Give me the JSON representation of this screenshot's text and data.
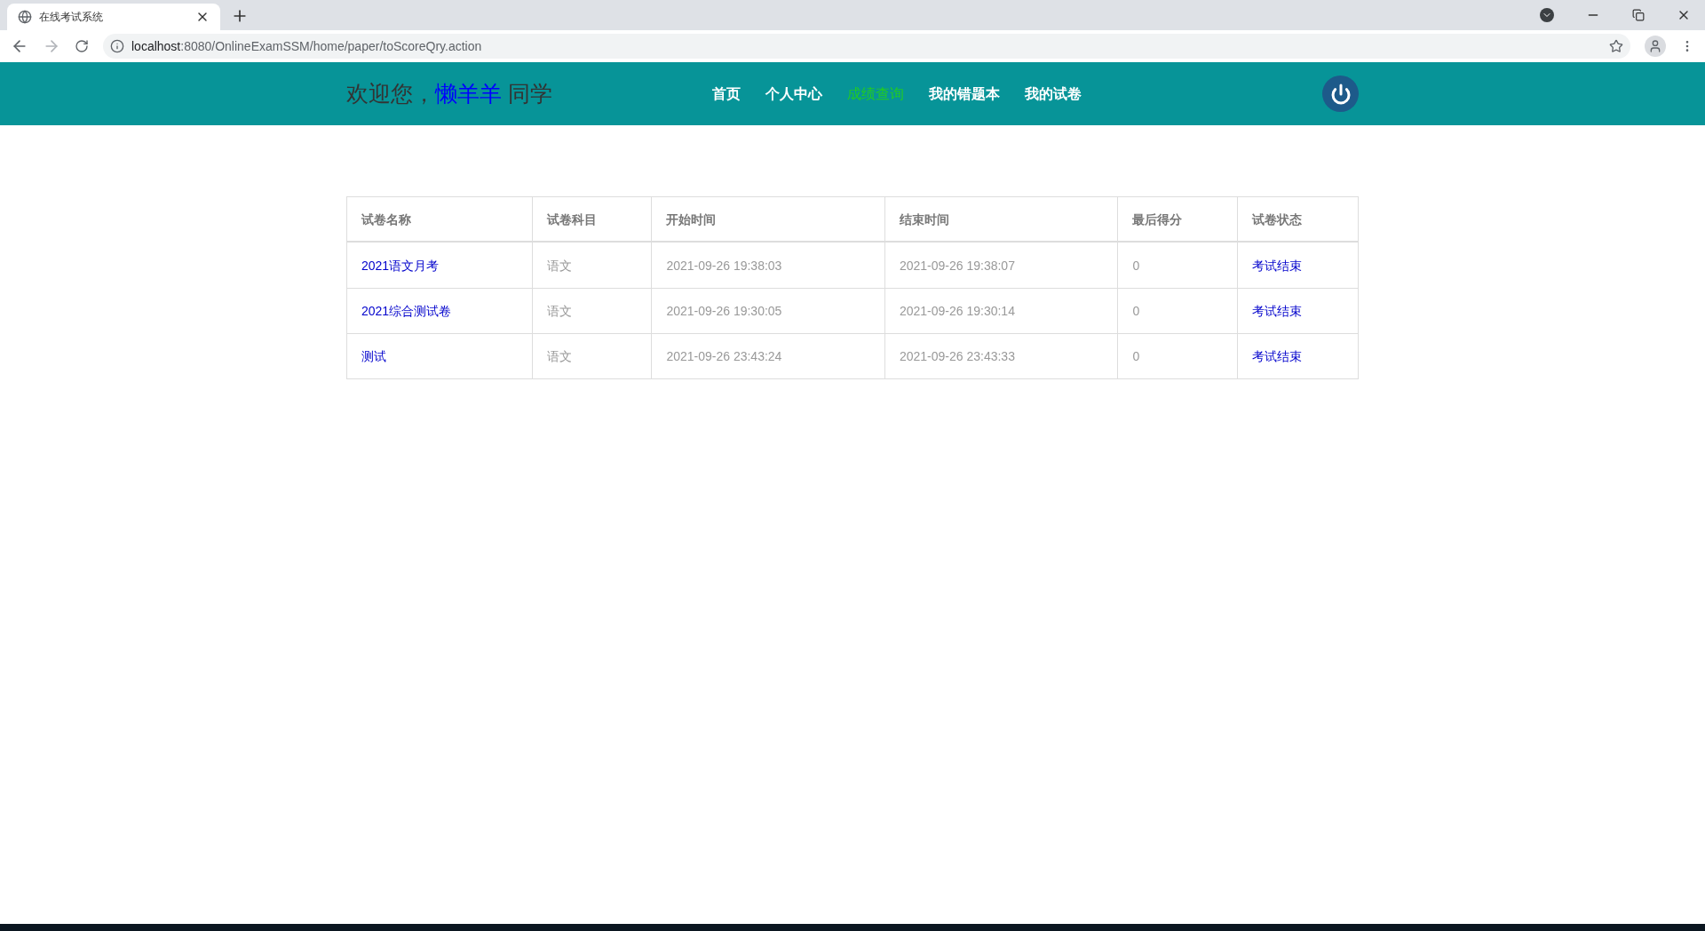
{
  "browser": {
    "tab_title": "在线考试系统",
    "url_host": "localhost",
    "url_rest": ":8080/OnlineExamSSM/home/paper/toScoreQry.action"
  },
  "header": {
    "greeting": "欢迎您，",
    "user": "懒羊羊",
    "suffix": "同学",
    "nav": [
      {
        "label": "首页",
        "selected": false
      },
      {
        "label": "个人中心",
        "selected": false
      },
      {
        "label": "成绩查询",
        "selected": true
      },
      {
        "label": "我的错题本",
        "selected": false
      },
      {
        "label": "我的试卷",
        "selected": false
      }
    ]
  },
  "table": {
    "columns": [
      "试卷名称",
      "试卷科目",
      "开始时间",
      "结束时间",
      "最后得分",
      "试卷状态"
    ],
    "rows": [
      {
        "name": "2021语文月考",
        "subject": "语文",
        "start": "2021-09-26 19:38:03",
        "end": "2021-09-26 19:38:07",
        "score": "0",
        "status": "考试结束"
      },
      {
        "name": "2021综合测试卷",
        "subject": "语文",
        "start": "2021-09-26 19:30:05",
        "end": "2021-09-26 19:30:14",
        "score": "0",
        "status": "考试结束"
      },
      {
        "name": "测试",
        "subject": "语文",
        "start": "2021-09-26 23:43:24",
        "end": "2021-09-26 23:43:33",
        "score": "0",
        "status": "考试结束"
      }
    ]
  }
}
